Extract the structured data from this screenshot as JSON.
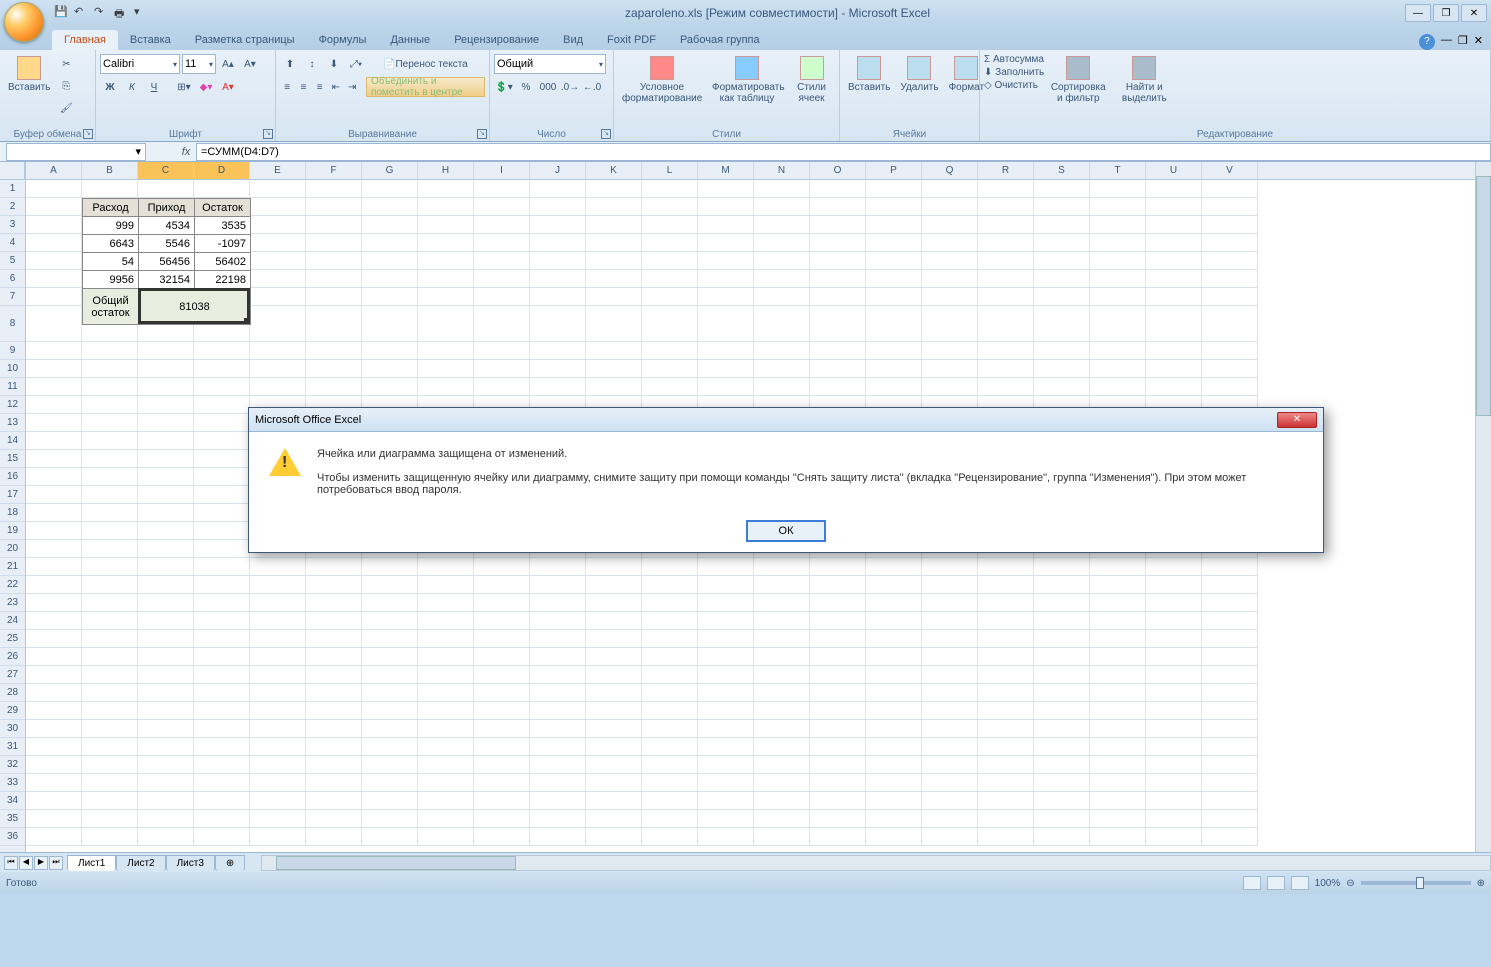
{
  "title": "zaparoleno.xls  [Режим совместимости] - Microsoft Excel",
  "tabs": {
    "home": "Главная",
    "insert": "Вставка",
    "layout": "Разметка страницы",
    "formulas": "Формулы",
    "data": "Данные",
    "review": "Рецензирование",
    "view": "Вид",
    "foxit": "Foxit PDF",
    "workgroup": "Рабочая группа"
  },
  "ribbon": {
    "clipboard": {
      "label": "Буфер обмена",
      "paste": "Вставить"
    },
    "font": {
      "label": "Шрифт",
      "name": "Calibri",
      "size": "11",
      "bold": "Ж",
      "italic": "К",
      "underline": "Ч"
    },
    "alignment": {
      "label": "Выравнивание",
      "wrap": "Перенос текста",
      "merge": "Объединить и поместить в центре"
    },
    "number": {
      "label": "Число",
      "format": "Общий"
    },
    "styles": {
      "label": "Стили",
      "conditional": "Условное форматирование",
      "as_table": "Форматировать как таблицу",
      "cell_styles": "Стили ячеек"
    },
    "cells": {
      "label": "Ячейки",
      "insert": "Вставить",
      "delete": "Удалить",
      "format": "Формат"
    },
    "editing": {
      "label": "Редактирование",
      "autosum": "Σ Автосумма",
      "fill": "Заполнить",
      "clear": "Очистить",
      "sort": "Сортировка и фильтр",
      "find": "Найти и выделить"
    }
  },
  "namebox": "",
  "formula": "=СУММ(D4:D7)",
  "columns": [
    "A",
    "B",
    "C",
    "D",
    "E",
    "F",
    "G",
    "H",
    "I",
    "J",
    "K",
    "L",
    "M",
    "N",
    "O",
    "P",
    "Q",
    "R",
    "S",
    "T",
    "U",
    "V"
  ],
  "table": {
    "headers": [
      "Расход",
      "Приход",
      "Остаток"
    ],
    "rows": [
      [
        "999",
        "4534",
        "3535"
      ],
      [
        "6643",
        "5546",
        "-1097"
      ],
      [
        "54",
        "56456",
        "56402"
      ],
      [
        "9956",
        "32154",
        "22198"
      ]
    ],
    "total_label": "Общий остаток",
    "total_value": "81038"
  },
  "sheets": {
    "s1": "Лист1",
    "s2": "Лист2",
    "s3": "Лист3"
  },
  "status": {
    "ready": "Готово",
    "zoom": "100%"
  },
  "dialog": {
    "title": "Microsoft Office Excel",
    "line1": "Ячейка или диаграмма защищена от изменений.",
    "line2": "Чтобы изменить защищенную ячейку или диаграмму, снимите защиту при помощи команды \"Снять защиту листа\" (вкладка \"Рецензирование\", группа \"Изменения\"). При этом может потребоваться ввод пароля.",
    "ok": "ОК"
  }
}
